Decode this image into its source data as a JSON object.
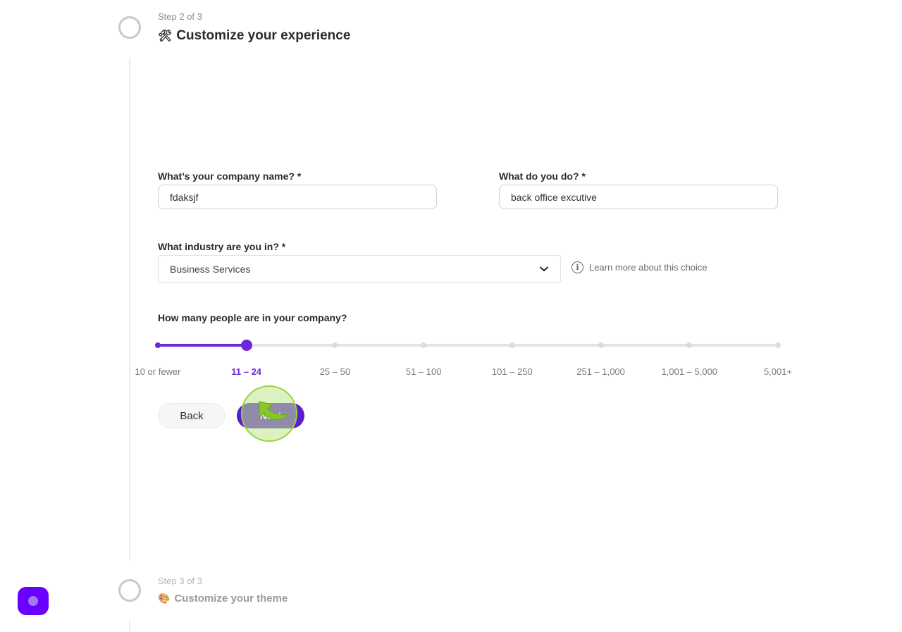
{
  "steps": {
    "current": {
      "label": "Step 2 of 3",
      "title": "Customize your experience",
      "icon": "hammer-and-wrench-icon",
      "icon_glyph": "🛠"
    },
    "next": {
      "label": "Step 3 of 3",
      "title": "Customize your theme",
      "icon": "palette-icon",
      "icon_glyph": "🎨"
    }
  },
  "form": {
    "company_name": {
      "label": "What’s your company name? *",
      "value": "fdaksjf"
    },
    "role": {
      "label": "What do you do? *",
      "value": "back office excutive"
    },
    "industry": {
      "label": "What industry are you in? *",
      "selected": "Business Services"
    },
    "learn_more": "Learn more about this choice",
    "company_size": {
      "label": "How many people are in your company?",
      "options": [
        "10 or fewer",
        "11 – 24",
        "25 – 50",
        "51 – 100",
        "101 – 250",
        "251 – 1,000",
        "1,001 – 5,000",
        "5,001+"
      ],
      "selected_index": 1
    }
  },
  "buttons": {
    "back": "Back",
    "next": "Next"
  },
  "colors": {
    "accent": "#6d28d9",
    "next_button": "#5b1ecf",
    "fab": "#6a00ff",
    "click_highlight": "#9cd33a"
  }
}
